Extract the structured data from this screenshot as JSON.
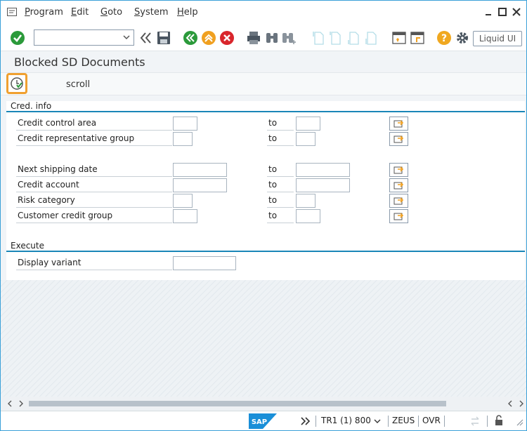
{
  "menu": {
    "items": [
      "Program",
      "Edit",
      "Goto",
      "System",
      "Help"
    ]
  },
  "toolbar": {
    "command_value": "",
    "liquid_ui_label": "Liquid UI"
  },
  "page": {
    "title": "Blocked SD Documents",
    "scroll_label": "scroll"
  },
  "groups": {
    "cred_info": "Cred. info",
    "execute": "Execute"
  },
  "fields": {
    "to_label": "to",
    "credit_control_area": "Credit control area",
    "credit_representative_group": "Credit representative group",
    "next_shipping_date": "Next shipping date",
    "credit_account": "Credit account",
    "risk_category": "Risk category",
    "customer_credit_group": "Customer credit group",
    "display_variant": "Display variant"
  },
  "status": {
    "system": "TR1 (1) 800",
    "server": "ZEUS",
    "mode": "OVR"
  },
  "colors": {
    "accent": "#1a86b8",
    "highlight": "#f0a030",
    "enter_green": "#2b9a3a",
    "exit_red": "#d9262c",
    "cancel_orange": "#f0a020"
  }
}
